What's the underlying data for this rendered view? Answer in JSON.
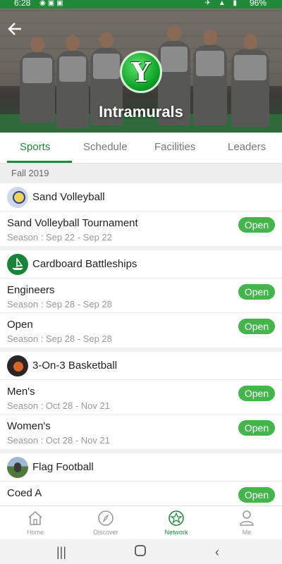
{
  "status_bar": {
    "time": "6:28",
    "battery": "96%"
  },
  "header": {
    "title": "Intramurals",
    "logo_letter": "Y"
  },
  "tabs": [
    {
      "label": "Sports",
      "active": true
    },
    {
      "label": "Schedule",
      "active": false
    },
    {
      "label": "Facilities",
      "active": false
    },
    {
      "label": "Leaders",
      "active": false
    }
  ],
  "season_header": "Fall 2019",
  "groups": [
    {
      "title": "Sand Volleyball",
      "icon": "volleyball-icon",
      "rows": [
        {
          "title": "Sand Volleyball Tournament",
          "season": "Season : Sep 22 - Sep 22",
          "badge": "Open"
        }
      ]
    },
    {
      "title": "Cardboard Battleships",
      "icon": "battleship-icon",
      "rows": [
        {
          "title": "Engineers",
          "season": "Season : Sep 28 - Sep 28",
          "badge": "Open"
        },
        {
          "title": "Open",
          "season": "Season : Sep 28 - Sep 28",
          "badge": "Open"
        }
      ]
    },
    {
      "title": "3-On-3 Basketball",
      "icon": "basketball-icon",
      "rows": [
        {
          "title": "Men's",
          "season": "Season : Oct 28 - Nov 21",
          "badge": "Open"
        },
        {
          "title": "Women's",
          "season": "Season : Oct 28 - Nov 21",
          "badge": "Open"
        }
      ]
    },
    {
      "title": "Flag Football",
      "icon": "football-icon",
      "rows": [
        {
          "title": "Coed A",
          "season": "",
          "badge": "Open"
        }
      ]
    }
  ],
  "bottom_nav": [
    {
      "label": "Home",
      "icon": "home-icon"
    },
    {
      "label": "Discover",
      "icon": "compass-icon"
    },
    {
      "label": "Network",
      "icon": "network-icon",
      "active": true
    },
    {
      "label": "Me",
      "icon": "person-icon"
    }
  ],
  "colors": {
    "accent": "#1f8a3a",
    "badge": "#44b54b"
  }
}
